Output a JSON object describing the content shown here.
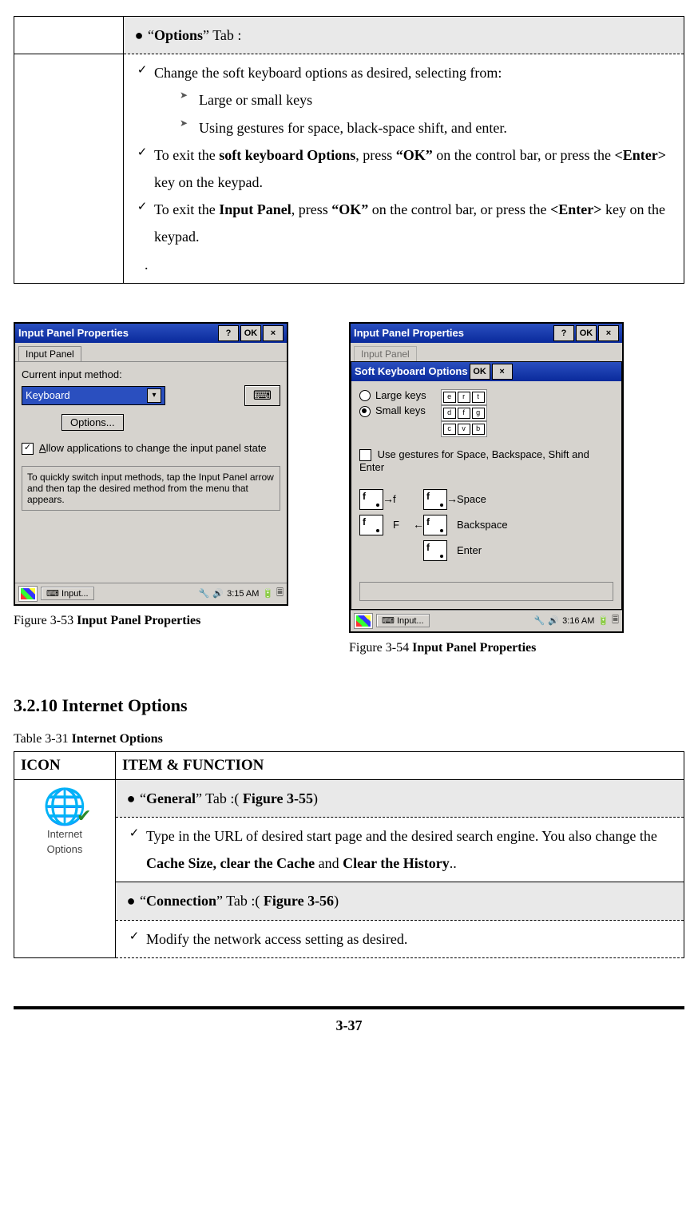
{
  "top_table": {
    "header": {
      "pre": "“",
      "bold": "Options",
      "post": "” Tab :"
    },
    "items": [
      {
        "type": "check",
        "text": "Change the soft keyboard options as desired, selecting from:"
      },
      {
        "type": "tri",
        "text": "Large or small keys"
      },
      {
        "type": "tri",
        "text": "Using gestures for space, black-space shift, and enter."
      },
      {
        "type": "check",
        "runs": [
          "To exit the ",
          {
            "b": "soft keyboard Options"
          },
          ", press ",
          {
            "b": "“OK”"
          },
          " on the control bar, or press the ",
          {
            "b": "<Enter>"
          },
          " key on the keypad."
        ]
      },
      {
        "type": "check",
        "runs": [
          "To exit the ",
          {
            "b": "Input Panel"
          },
          ", press ",
          {
            "b": "“OK”"
          },
          " on the control bar, or press the ",
          {
            "b": "<Enter>"
          },
          " key on the keypad."
        ]
      }
    ],
    "trailing_dot": "."
  },
  "fig_left": {
    "title": "Input Panel Properties",
    "tab": "Input Panel",
    "label_method": "Current input method:",
    "combo": "Keyboard",
    "btn_options": "Options...",
    "chk_allow": "Allow applications to change the input panel state",
    "hint": "To quickly switch input methods, tap the Input Panel arrow and then tap the desired method from the menu that appears.",
    "task_label": "Input...",
    "time": "3:15 AM",
    "caption_pre": "Figure 3-53 ",
    "caption_bold": "Input Panel Properties"
  },
  "fig_right": {
    "title": "Input Panel Properties",
    "tab": "Input Panel",
    "soft_title": "Soft Keyboard Options",
    "opt_large": "Large keys",
    "opt_small": "Small keys",
    "chk_gest": "Use gestures for Space, Backspace, Shift and Enter",
    "g_space": "Space",
    "g_back": "Backspace",
    "g_enter": "Enter",
    "g_f": "f",
    "g_F": "F",
    "task_label": "Input...",
    "time": "3:16 AM",
    "caption_pre": "Figure 3-54 ",
    "caption_bold": "Input Panel Properties"
  },
  "section_heading": "3.2.10 Internet Options",
  "table2": {
    "caption_pre": "Table 3-31 ",
    "caption_bold": "Internet Options",
    "col1": "ICON",
    "col2": "ITEM & FUNCTION",
    "icon_label1": "Internet",
    "icon_label2": "Options",
    "row1_header": {
      "pre": "“",
      "bold": "General",
      "mid": "” Tab :( ",
      "fig": "Figure 3-55",
      "end": ")"
    },
    "row1_body_runs": [
      "Type in the URL of desired start page and the desired search engine. You also change the ",
      {
        "b": "Cache Size, clear the Cache"
      },
      " and ",
      {
        "b": "Clear the History"
      },
      ".."
    ],
    "row2_header": {
      "pre": "“",
      "bold": "Connection",
      "mid": "” Tab :( ",
      "fig": "Figure 3-56",
      "end": ")"
    },
    "row2_body": "Modify the network access setting as desired."
  },
  "page_num": "3-37",
  "btn_help": "?",
  "btn_ok": "OK",
  "btn_close": "×"
}
